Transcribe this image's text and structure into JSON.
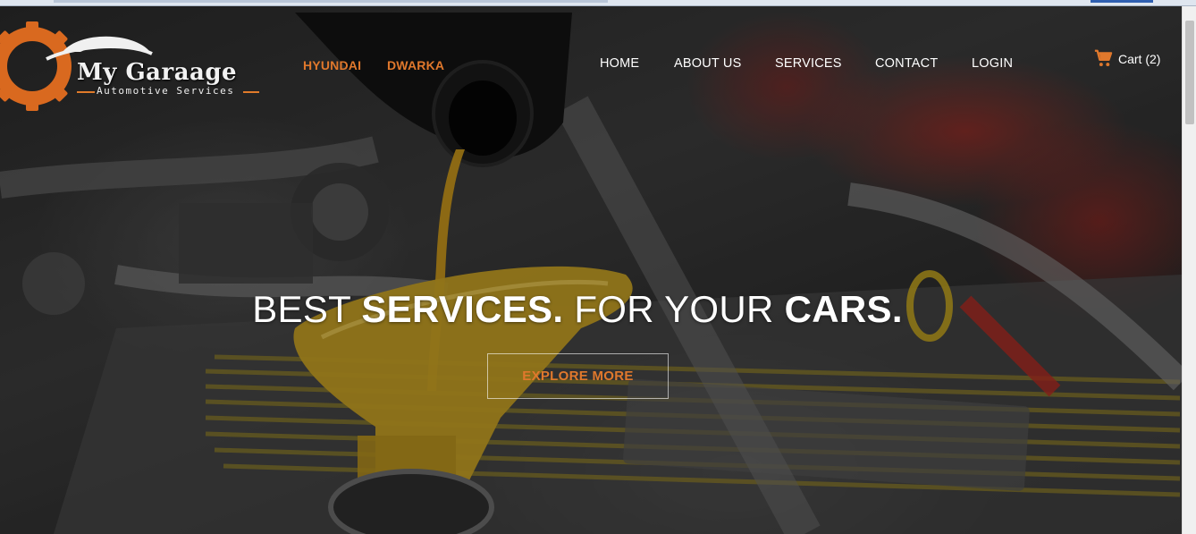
{
  "logo": {
    "title": "My Garaage",
    "subtitle": "Automotive Services"
  },
  "nav_left": [
    "HYUNDAI",
    "DWARKA"
  ],
  "nav_right": [
    "HOME",
    "ABOUT US",
    "SERVICES",
    "CONTACT",
    "LOGIN"
  ],
  "cart": {
    "label": "Cart (2)",
    "icon": "shopping-cart-icon"
  },
  "hero": {
    "headline_1": "BEST",
    "headline_2": "SERVICES.",
    "headline_3": "FOR YOUR",
    "headline_4": "CARS.",
    "button_label": "EXPLORE MORE"
  },
  "colors": {
    "accent": "#e0782c",
    "nav_text": "#ffffff",
    "gear": "#d9691f"
  }
}
